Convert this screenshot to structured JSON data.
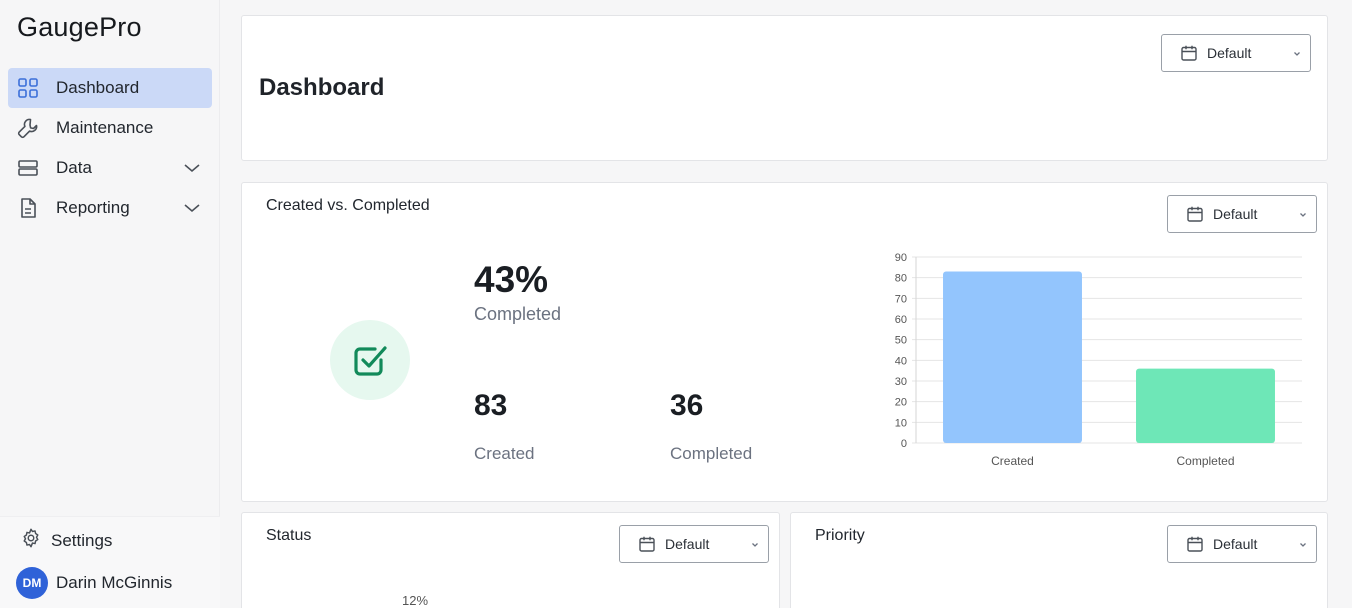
{
  "app": {
    "brand": "GaugePro"
  },
  "sidebar": {
    "items": [
      {
        "label": "Dashboard",
        "icon": "grid-icon",
        "active": true
      },
      {
        "label": "Maintenance",
        "icon": "wrench-icon"
      },
      {
        "label": "Data",
        "icon": "database-icon",
        "expandable": true
      },
      {
        "label": "Reporting",
        "icon": "document-icon",
        "expandable": true
      }
    ],
    "settings_label": "Settings",
    "user": {
      "initials": "DM",
      "name": "Darin McGinnis"
    }
  },
  "header": {
    "title": "Dashboard",
    "date_filter": "Default"
  },
  "created_vs_completed": {
    "title": "Created vs. Completed",
    "date_filter": "Default",
    "percent": "43%",
    "percent_label": "Completed",
    "created_count": "83",
    "created_label": "Created",
    "completed_count": "36",
    "completed_label": "Completed"
  },
  "status": {
    "title": "Status",
    "date_filter": "Default",
    "pie_label": "12%"
  },
  "priority": {
    "title": "Priority",
    "date_filter": "Default"
  },
  "colors": {
    "accent": "#2f62d8",
    "active_nav": "#cbd9f7",
    "created_bar": "#93c5fd",
    "completed_bar": "#6ee7b7",
    "check": "#128a5a"
  },
  "chart_data": {
    "type": "bar",
    "categories": [
      "Created",
      "Completed"
    ],
    "values": [
      83,
      36
    ],
    "ylim": [
      0,
      90
    ],
    "yticks": [
      0,
      10,
      20,
      30,
      40,
      50,
      60,
      70,
      80,
      90
    ],
    "grid": true,
    "bar_colors": [
      "#93c5fd",
      "#6ee7b7"
    ]
  }
}
